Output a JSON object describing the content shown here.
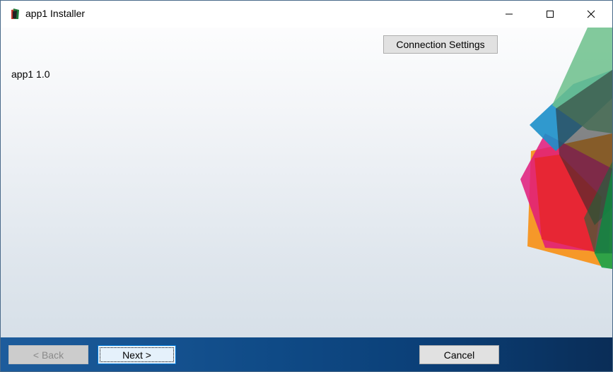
{
  "window": {
    "title": "app1 Installer",
    "controls": {
      "minimize": "minimize-icon",
      "maximize": "maximize-icon",
      "close": "close-icon"
    }
  },
  "header": {
    "connection_settings_label": "Connection Settings"
  },
  "main": {
    "product_label": "app1 1.0"
  },
  "footer": {
    "back_label": "< Back",
    "next_label": "Next >",
    "cancel_label": "Cancel",
    "back_enabled": false
  },
  "colors": {
    "footer_blue": "#0f4a86",
    "focus_border": "#0078d7"
  }
}
